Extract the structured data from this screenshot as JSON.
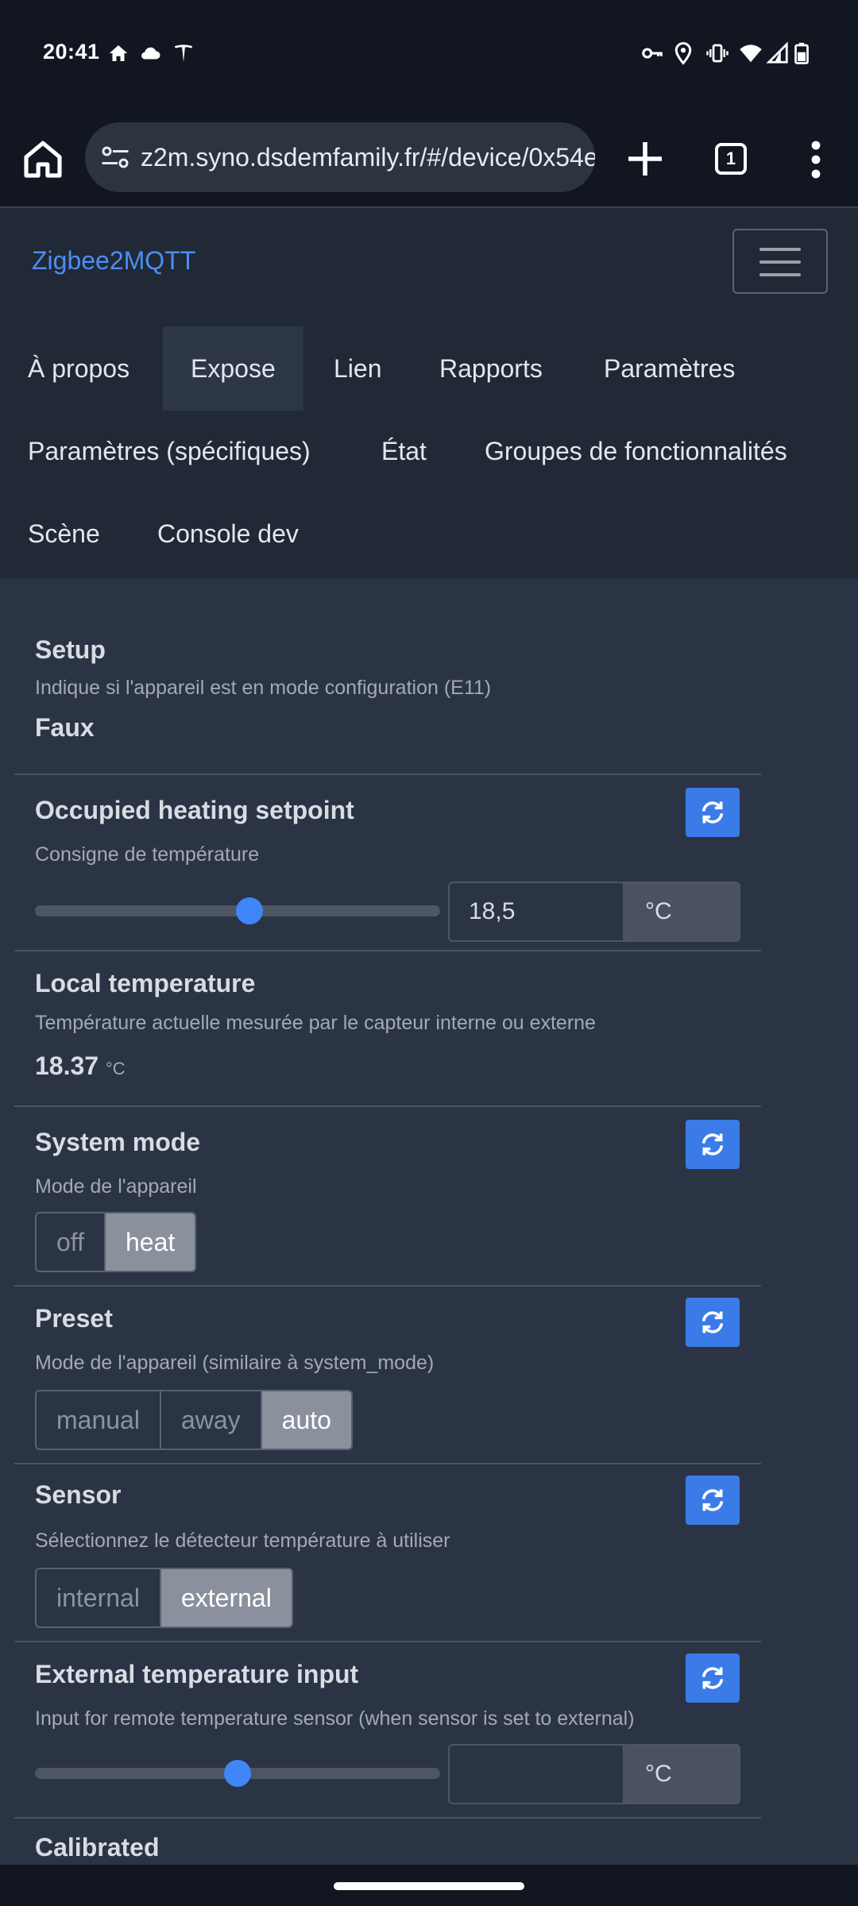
{
  "status_bar": {
    "time": "20:41",
    "left_icons": [
      "home-icon",
      "cloud-icon",
      "tesla-icon"
    ],
    "right_icons": [
      "key-icon",
      "location-icon",
      "vibrate-icon",
      "wifi-icon",
      "signal-icon",
      "battery-icon"
    ]
  },
  "browser": {
    "url": "z2m.syno.dsdemfamily.fr/#/device/0x54e",
    "tab_count": "1"
  },
  "navbar": {
    "brand": "Zigbee2MQTT",
    "links": [
      "À propos",
      "Expose",
      "Lien",
      "Rapports",
      "Paramètres",
      "Paramètres (spécifiques)",
      "État",
      "Groupes de fonctionnalités",
      "Scène",
      "Console dev"
    ],
    "active": "Expose"
  },
  "sections": {
    "setup": {
      "title": "Setup",
      "desc": "Indique si l'appareil est en mode configuration (E11)",
      "value": "Faux"
    },
    "heating": {
      "title": "Occupied heating setpoint",
      "desc": "Consigne de température",
      "value": "18,5",
      "unit": "°C",
      "slider_fraction": 0.53
    },
    "local_temp": {
      "title": "Local temperature",
      "desc": "Température actuelle mesurée par le capteur interne ou externe",
      "value": "18.37",
      "unit": "°C"
    },
    "system_mode": {
      "title": "System mode",
      "desc": "Mode de l'appareil",
      "options": [
        "off",
        "heat"
      ],
      "selected": "heat"
    },
    "preset": {
      "title": "Preset",
      "desc": "Mode de l'appareil (similaire à system_mode)",
      "options": [
        "manual",
        "away",
        "auto"
      ],
      "selected": "auto"
    },
    "sensor": {
      "title": "Sensor",
      "desc": "Sélectionnez le détecteur température à utiliser",
      "options": [
        "internal",
        "external"
      ],
      "selected": "external"
    },
    "ext_temp": {
      "title": "External temperature input",
      "desc": "Input for remote temperature sensor (when sensor is set to external)",
      "value": "",
      "unit": "°C",
      "slider_fraction": 0.5
    },
    "calibrated": {
      "title": "Calibrated"
    }
  },
  "colors": {
    "accent": "#3a7be8",
    "brand": "#4b8ef5",
    "background": "#2b3444",
    "navbar": "#212936"
  }
}
